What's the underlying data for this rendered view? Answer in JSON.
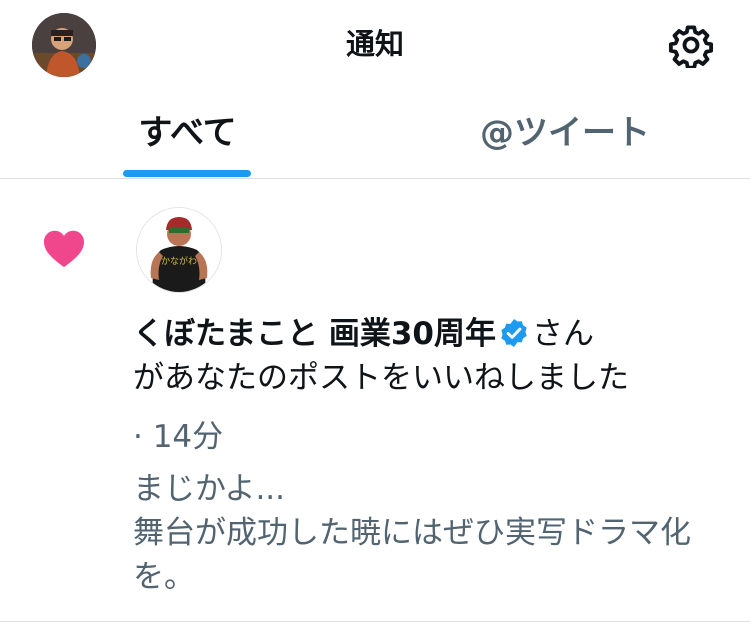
{
  "header": {
    "title": "通知",
    "avatar": "user-avatar",
    "settings_icon": "gear-icon"
  },
  "tabs": [
    {
      "label": "すべて",
      "active": true
    },
    {
      "label": "@ツイート",
      "active": false
    }
  ],
  "accent_color": "#1d9bf0",
  "notification": {
    "type_icon": "heart-icon",
    "heart_color": "#f0468c",
    "user_name": "くぼたまこと 画業30周年",
    "verified": true,
    "action_text_part1": "さん",
    "action_text_part2": "があなたのポストをいいねしました",
    "time": "· 14分",
    "preview_line1": "まじかよ...",
    "preview_line2": "舞台が成功した暁にはぜひ実写ドラマ化を。",
    "avatar_shirt_text": "かながわ"
  }
}
